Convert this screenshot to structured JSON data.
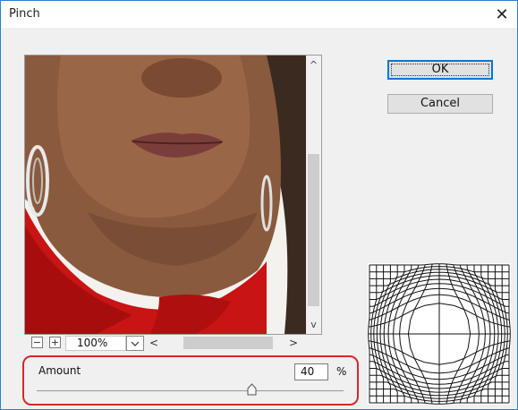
{
  "dialog": {
    "title": "Pinch",
    "close_glyph": "✕"
  },
  "buttons": {
    "ok_label": "OK",
    "cancel_label": "Cancel"
  },
  "preview": {
    "zoom_out_glyph": "−",
    "zoom_in_glyph": "+",
    "zoom_value": "100%",
    "scroll_up_glyph": "^",
    "scroll_down_glyph": "v",
    "scroll_left_glyph": "<",
    "scroll_right_glyph": ">"
  },
  "amount": {
    "label": "Amount",
    "value": "40",
    "unit": "%",
    "min": -100,
    "max": 100
  },
  "colors": {
    "highlight_border": "#d62828",
    "shirt_red": "#c81414",
    "skin": "#8a5a3e",
    "accent": "#0078d7"
  },
  "icons": {
    "close": "close-icon",
    "zoom_out": "zoom-out-icon",
    "zoom_in": "zoom-in-icon",
    "dropdown": "chevron-down-icon",
    "slider": "slider-thumb-icon",
    "grid": "pinch-grid-icon"
  }
}
